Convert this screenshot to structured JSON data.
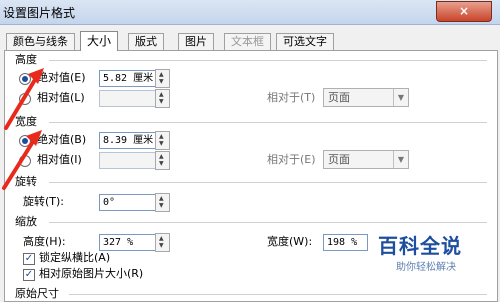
{
  "window": {
    "title": "设置图片格式",
    "close": "×"
  },
  "tabs": [
    {
      "label": "颜色与线条",
      "state": "normal"
    },
    {
      "label": "大小",
      "state": "active"
    },
    {
      "label": "版式",
      "state": "normal"
    },
    {
      "label": "图片",
      "state": "normal"
    },
    {
      "label": "文本框",
      "state": "disabled"
    },
    {
      "label": "可选文字",
      "state": "normal"
    }
  ],
  "height": {
    "section": "高度",
    "absolute_label": "绝对值(E)",
    "absolute_value": "5.82 厘米",
    "relative_label": "相对值(L)",
    "relative_to_label": "相对于(T)",
    "relative_to_value": "页面"
  },
  "width": {
    "section": "宽度",
    "absolute_label": "绝对值(B)",
    "absolute_value": "8.39 厘米",
    "relative_label": "相对值(I)",
    "relative_to_label": "相对于(E)",
    "relative_to_value": "页面"
  },
  "rotate": {
    "section": "旋转",
    "label": "旋转(T):",
    "value": "0°"
  },
  "scale": {
    "section": "缩放",
    "height_label": "高度(H):",
    "height_value": "327 %",
    "width_label": "宽度(W):",
    "width_value": "198 %",
    "lock_label": "锁定纵横比(A)",
    "lock_checked": true,
    "relative_label": "相对原始图片大小(R)",
    "relative_checked": true
  },
  "original": {
    "section": "原始尺寸"
  },
  "watermark": {
    "title": "百科全说",
    "subtitle": "助你轻松解决"
  },
  "colors": {
    "arrow": "#e8291c",
    "accent": "#1e4e9f"
  }
}
